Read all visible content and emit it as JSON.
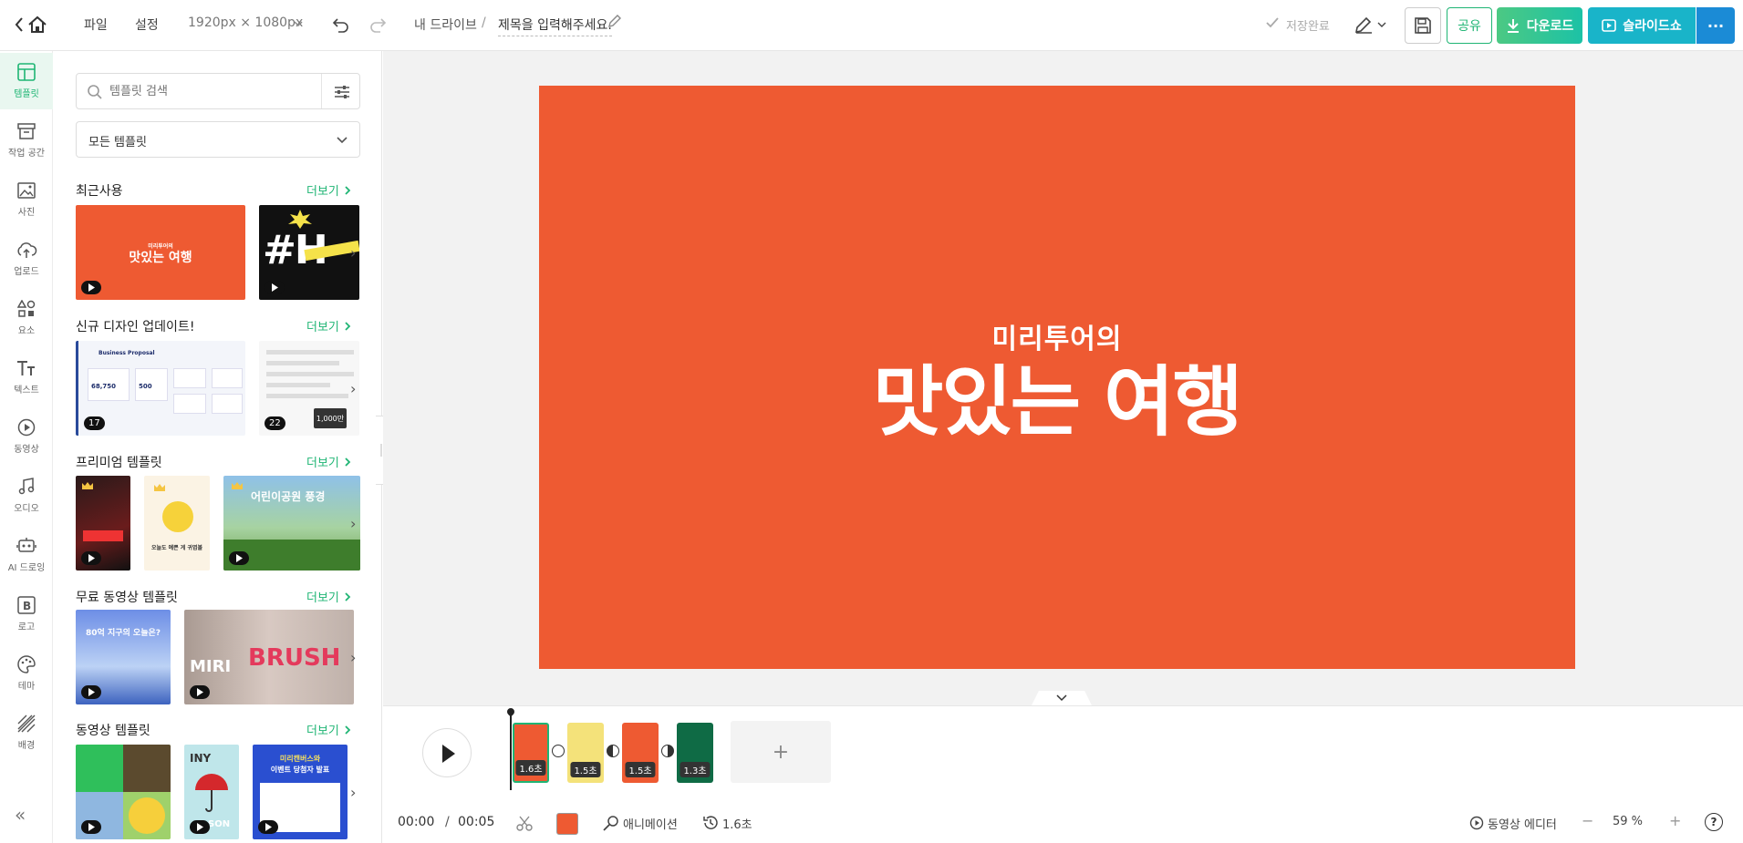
{
  "topbar": {
    "menu_file": "파일",
    "menu_settings": "설정",
    "canvas_size": "1920px × 1080px",
    "breadcrumb_drive": "내 드라이브",
    "breadcrumb_sep": "/",
    "doc_title": "제목을 입력해주세요.",
    "save_status": "저장완료",
    "share_label": "공유",
    "download_label": "다운로드",
    "slideshow_label": "슬라이드쇼",
    "more_label": "···"
  },
  "rail": {
    "items": [
      {
        "label": "템플릿",
        "icon": "template-icon"
      },
      {
        "label": "작업 공간",
        "icon": "archive-icon"
      },
      {
        "label": "사진",
        "icon": "photo-icon"
      },
      {
        "label": "업로드",
        "icon": "upload-cloud-icon"
      },
      {
        "label": "요소",
        "icon": "elements-icon"
      },
      {
        "label": "텍스트",
        "icon": "text-icon"
      },
      {
        "label": "동영상",
        "icon": "video-icon"
      },
      {
        "label": "오디오",
        "icon": "audio-icon"
      },
      {
        "label": "AI 드로잉",
        "icon": "ai-drawing-icon"
      },
      {
        "label": "로고",
        "icon": "logo-icon"
      },
      {
        "label": "테마",
        "icon": "palette-icon"
      },
      {
        "label": "배경",
        "icon": "background-icon"
      }
    ],
    "collapse": "«"
  },
  "panel": {
    "search_placeholder": "템플릿 검색",
    "filter_value": "모든 템플릿",
    "more_label": "더보기",
    "sections": [
      {
        "title": "최근사용"
      },
      {
        "title": "신규 디자인 업데이트!",
        "counts": [
          "17",
          "22"
        ]
      },
      {
        "title": "프리미엄 템플릿"
      },
      {
        "title": "무료 동영상 템플릿"
      },
      {
        "title": "동영상 템플릿"
      }
    ],
    "thumb_texts": {
      "recent_1_small": "미리투어의",
      "recent_1_big": "맛있는 여행",
      "recent_2": "#H",
      "new_1_title": "Business Proposal",
      "new_1_val1": "68,750",
      "new_1_val2": "500",
      "new_2_val": "1,000만",
      "free_1": "80억 지구의 오늘은?",
      "free_2a": "MIRI",
      "free_2b": "BRUSH",
      "video_3a": "미리캔버스와",
      "video_3b": "이벤트 당첨자 발표",
      "video_2a": "INY",
      "video_2b": "SON",
      "prem_2": "오늘도 예쁜 게 귀엽볼",
      "prem_3": "어린이공원 풍경"
    }
  },
  "slide": {
    "subtitle": "미리투어의",
    "title": "맛있는 여행",
    "bg_color": "#ee5a32"
  },
  "timeline": {
    "frames": [
      {
        "duration": "1.6초",
        "color": "#ee5a32"
      },
      {
        "duration": "1.5초",
        "color": "#f4e27a"
      },
      {
        "duration": "1.5초",
        "color": "#ee5a32"
      },
      {
        "duration": "1.3초",
        "color": "#0f6b45"
      }
    ],
    "add_label": "+",
    "current_time": "00:00",
    "time_sep": "/",
    "total_time": "00:05",
    "animation_label": "애니메이션",
    "page_duration": "1.6초",
    "video_editor_label": "동영상 에디터",
    "zoom_minus": "−",
    "zoom_value": "59 %",
    "zoom_plus": "+",
    "help": "?"
  },
  "colors": {
    "accent": "#1fb574",
    "slide_bg": "#ee5a32",
    "slideshow": "#19b4c9"
  }
}
